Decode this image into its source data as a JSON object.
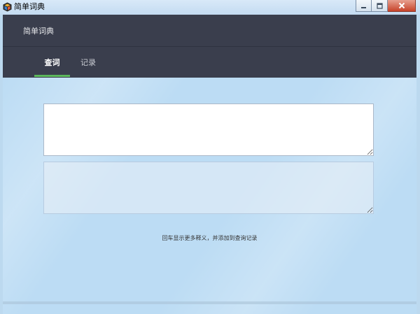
{
  "window": {
    "title": "简单词典",
    "icon": "app-cube-icon",
    "controls": [
      "minimize-icon",
      "maximize-icon",
      "close-icon"
    ]
  },
  "header": {
    "app_name": "简单词典",
    "background": "#3a3e4d",
    "tabs": [
      {
        "label": "查词",
        "active": true
      },
      {
        "label": "记录",
        "active": false
      }
    ],
    "active_indicator_color": "#5cb85c"
  },
  "main": {
    "input_value": "",
    "output_value": "",
    "hint": "回车显示更多释义，并添加到查询记录"
  }
}
